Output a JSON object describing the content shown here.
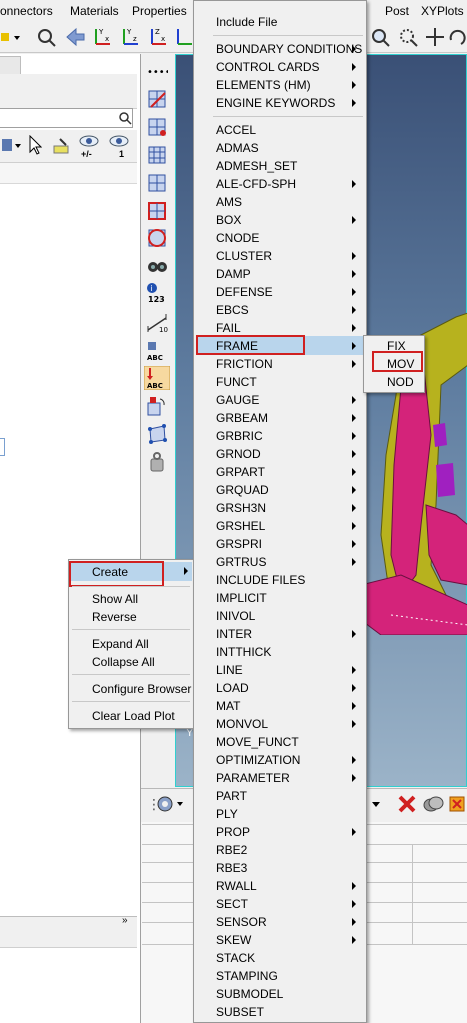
{
  "menubar": {
    "items": [
      "onnectors",
      "Materials",
      "Properties",
      "Post",
      "XYPlots"
    ]
  },
  "main_menu": {
    "top_item": "Include File",
    "group1": [
      "BOUNDARY CONDITIONS",
      "CONTROL CARDS",
      "ELEMENTS (HM)",
      "ENGINE KEYWORDS"
    ],
    "group2": [
      "ACCEL",
      "ADMAS",
      "ADMESH_SET",
      "ALE-CFD-SPH",
      "AMS",
      "BOX",
      "CNODE",
      "CLUSTER",
      "DAMP",
      "DEFENSE",
      "EBCS",
      "FAIL",
      "FRAME",
      "FRICTION",
      "FUNCT",
      "GAUGE",
      "GRBEAM",
      "GRBRIC",
      "GRNOD",
      "GRPART",
      "GRQUAD",
      "GRSH3N",
      "GRSHEL",
      "GRSPRI",
      "GRTRUS",
      "INCLUDE FILES",
      "IMPLICIT",
      "INIVOL",
      "INTER",
      "INTTHICK",
      "LINE",
      "LOAD",
      "MAT",
      "MONVOL",
      "MOVE_FUNCT",
      "OPTIMIZATION",
      "PARAMETER",
      "PART",
      "PLY",
      "PROP",
      "RBE2",
      "RBE3",
      "RWALL",
      "SECT",
      "SENSOR",
      "SKEW",
      "STACK",
      "STAMPING",
      "SUBMODEL",
      "SUBSET"
    ],
    "highlighted": "FRAME"
  },
  "frame_submenu": {
    "items": [
      "FIX",
      "MOV",
      "NOD"
    ],
    "highlighted": "MOV"
  },
  "context_menu": {
    "items": [
      "Create",
      "Show All",
      "Reverse",
      "Expand All",
      "Collapse All",
      "Configure Browser",
      "Clear Load Plot"
    ],
    "highlighted": "Create"
  },
  "icons": {
    "toolbar": [
      "zoom-icon",
      "arrow-left-icon",
      "axis-yx-icon",
      "axis-zx-icon",
      "axis-zy-icon",
      "magnify-icon",
      "magnify-dotted-icon",
      "pan-icon",
      "rotate-icon"
    ],
    "vertical": [
      "dots-icon",
      "mesh-red-icon",
      "mesh-check-icon",
      "mesh-grid-icon",
      "mesh-plain-icon",
      "mesh-box-icon",
      "mesh-circle-icon",
      "binoculars-icon",
      "info-123-icon",
      "distance-icon",
      "abc-icon",
      "load-abc-icon",
      "plot-icon",
      "selection-box-icon",
      "weight-icon"
    ]
  },
  "colors": {
    "highlight": "#b9d5ec",
    "annotation": "#d02020",
    "viewport_border": "#30d0d0",
    "model_magenta": "#d4237a",
    "model_yellow": "#b7b21e"
  },
  "eye_labels": [
    "+/-",
    "1"
  ]
}
